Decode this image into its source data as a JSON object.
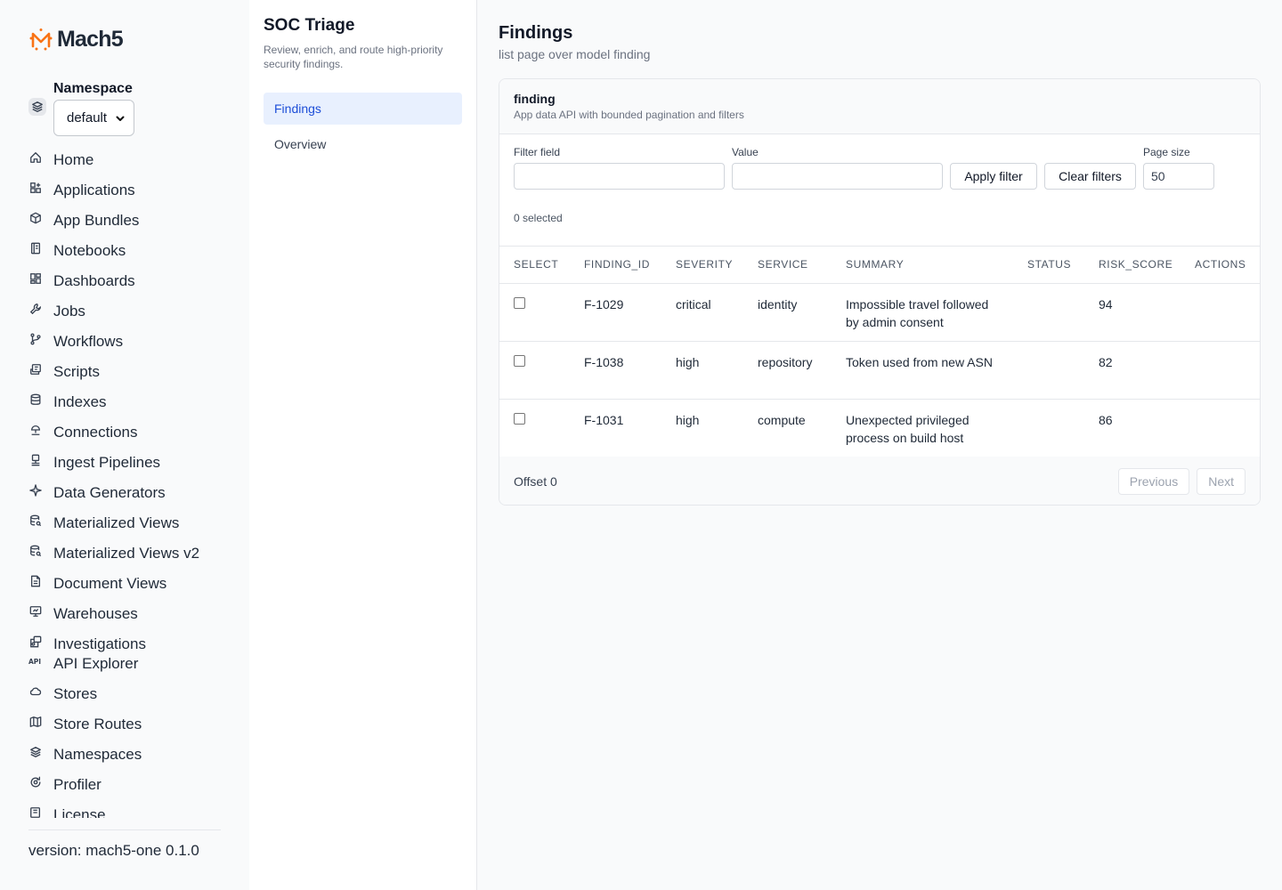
{
  "brand": {
    "name": "Mach5",
    "accent": "#f97316"
  },
  "namespace": {
    "label": "Namespace",
    "selected": "default"
  },
  "nav": {
    "items": [
      {
        "label": "Home",
        "icon": "home-icon"
      },
      {
        "label": "Applications",
        "icon": "applications-icon"
      },
      {
        "label": "App Bundles",
        "icon": "package-icon"
      },
      {
        "label": "Notebooks",
        "icon": "notebook-icon"
      },
      {
        "label": "Dashboards",
        "icon": "dashboard-icon"
      },
      {
        "label": "Jobs",
        "icon": "wrench-icon"
      },
      {
        "label": "Workflows",
        "icon": "git-branch-icon"
      },
      {
        "label": "Scripts",
        "icon": "script-icon"
      },
      {
        "label": "Indexes",
        "icon": "database-icon"
      },
      {
        "label": "Connections",
        "icon": "connection-icon"
      },
      {
        "label": "Ingest Pipelines",
        "icon": "pipeline-icon"
      },
      {
        "label": "Data Generators",
        "icon": "sparkle-icon"
      },
      {
        "label": "Materialized Views",
        "icon": "database-search-icon"
      },
      {
        "label": "Materialized Views v2",
        "icon": "database-search-icon"
      },
      {
        "label": "Document Views",
        "icon": "document-icon"
      },
      {
        "label": "Warehouses",
        "icon": "monitor-icon"
      },
      {
        "label": "Investigations",
        "icon": "investigation-icon"
      },
      {
        "label": "API Explorer",
        "icon": "api-icon"
      },
      {
        "label": "Stores",
        "icon": "cloud-icon"
      },
      {
        "label": "Store Routes",
        "icon": "map-icon"
      },
      {
        "label": "Namespaces",
        "icon": "layers-icon"
      },
      {
        "label": "Profiler",
        "icon": "profiler-icon"
      },
      {
        "label": "License",
        "icon": "license-icon"
      }
    ]
  },
  "version": "version: mach5-one 0.1.0",
  "app": {
    "title": "SOC Triage",
    "description": "Review, enrich, and route high-priority security findings.",
    "links": [
      {
        "label": "Findings",
        "active": true
      },
      {
        "label": "Overview",
        "active": false
      }
    ]
  },
  "page": {
    "title": "Findings",
    "subtitle": "list page over model finding"
  },
  "card": {
    "title": "finding",
    "subtitle": "App data API with bounded pagination and filters"
  },
  "filters": {
    "field_label": "Filter field",
    "field_value": "",
    "value_label": "Value",
    "value_value": "",
    "apply_label": "Apply filter",
    "clear_label": "Clear filters",
    "page_size_label": "Page size",
    "page_size_value": "50",
    "selected_text": "0 selected"
  },
  "table": {
    "columns": [
      "SELECT",
      "FINDING_ID",
      "SEVERITY",
      "SERVICE",
      "SUMMARY",
      "STATUS",
      "RISK_SCORE",
      "ACTIONS"
    ],
    "rows": [
      {
        "finding_id": "F-1029",
        "severity": "critical",
        "service": "identity",
        "summary": "Impossible travel followed by admin consent",
        "status": "",
        "risk_score": "94",
        "checked": false
      },
      {
        "finding_id": "F-1038",
        "severity": "high",
        "service": "repository",
        "summary": "Token used from new ASN",
        "status": "",
        "risk_score": "82",
        "checked": false
      },
      {
        "finding_id": "F-1031",
        "severity": "high",
        "service": "compute",
        "summary": "Unexpected privileged process on build host",
        "status": "",
        "risk_score": "86",
        "checked": false
      }
    ]
  },
  "footer": {
    "offset_text": "Offset 0",
    "previous_label": "Previous",
    "next_label": "Next"
  }
}
